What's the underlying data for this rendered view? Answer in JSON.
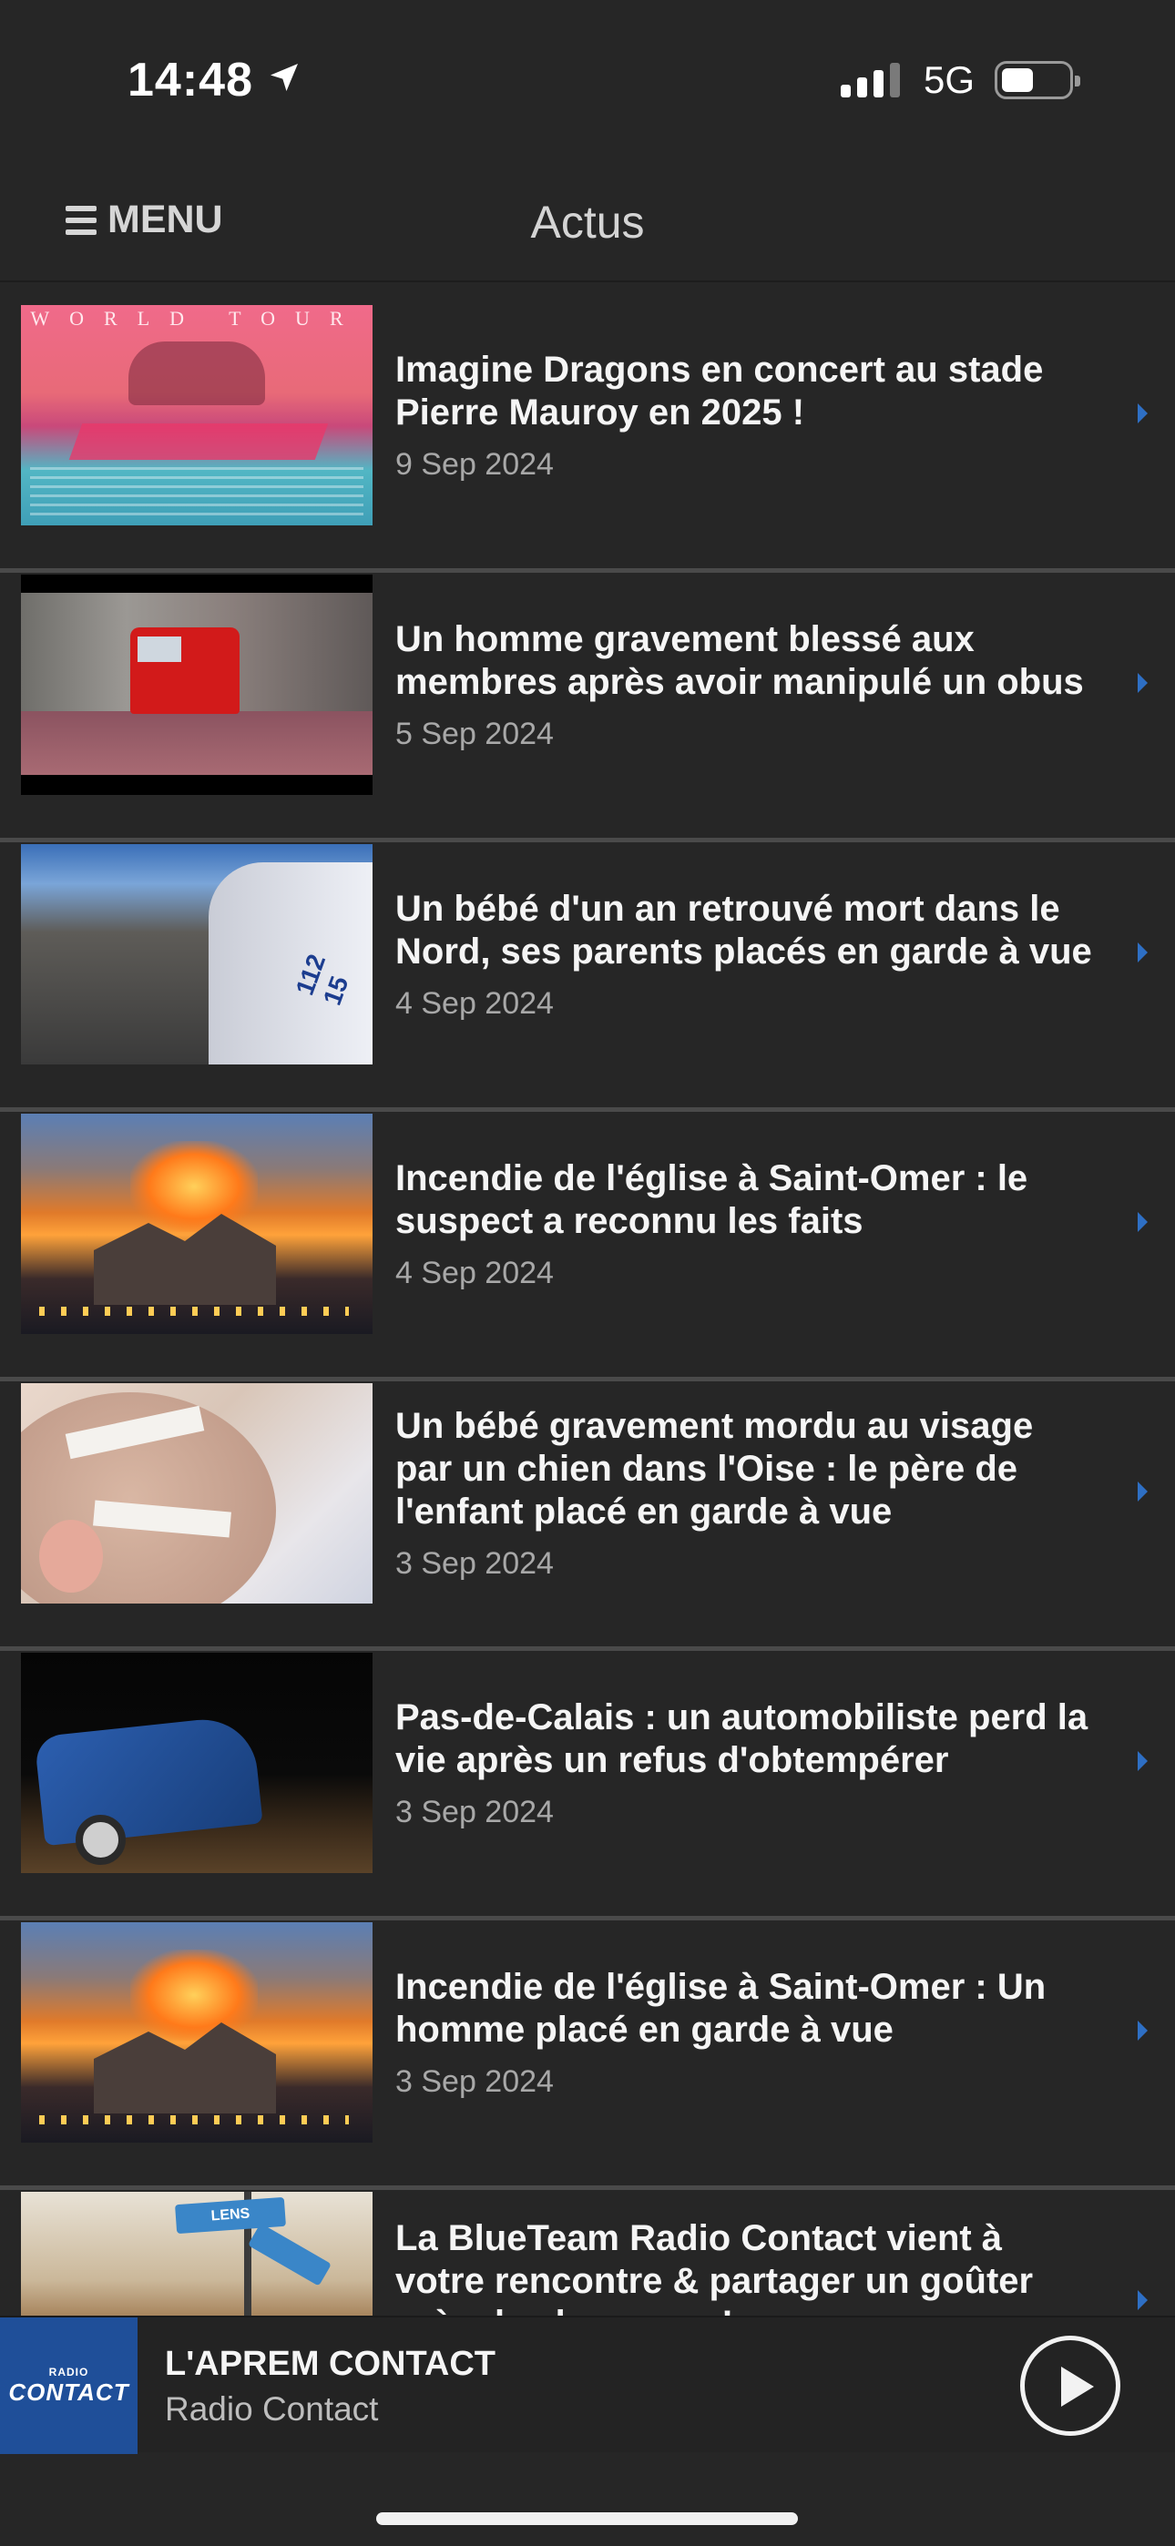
{
  "status_bar": {
    "time": "14:48",
    "network": "5G"
  },
  "nav": {
    "menu_label": "MENU",
    "title": "Actus"
  },
  "articles": [
    {
      "title": "Imagine Dragons en concert au stade Pierre Mauroy en 2025 !",
      "date": "9 Sep 2024",
      "thumb_text": "WORLD TOUR"
    },
    {
      "title": "Un homme gravement blessé aux membres après avoir manipulé un obus",
      "date": "5 Sep 2024"
    },
    {
      "title": "Un bébé d'un an retrouvé mort dans le Nord, ses parents placés en garde à vue",
      "date": "4 Sep 2024",
      "thumb_text": "112 15"
    },
    {
      "title": "Incendie de l'église à Saint-Omer : le suspect a reconnu les faits",
      "date": "4 Sep 2024"
    },
    {
      "title": "Un bébé gravement mordu au visage par un chien dans l'Oise : le père de l'enfant placé en garde à vue",
      "date": "3 Sep 2024"
    },
    {
      "title": "Pas-de-Calais : un automobiliste perd la vie après un refus d'obtempérer",
      "date": "3 Sep 2024"
    },
    {
      "title": "Incendie de l'église à Saint-Omer : Un homme placé en garde à vue",
      "date": "3 Sep 2024"
    },
    {
      "title": "La BlueTeam Radio Contact vient à votre rencontre & partager un goûter près de chez vous !",
      "date": "",
      "thumb_text": "LENS"
    }
  ],
  "player": {
    "logo_top": "RADIO",
    "logo_main": "CONTACT",
    "title": "L'APREM CONTACT",
    "station": "Radio Contact"
  },
  "colors": {
    "background": "#262626",
    "accent": "#2e6fc4",
    "logo_bg": "#1f4f99"
  }
}
